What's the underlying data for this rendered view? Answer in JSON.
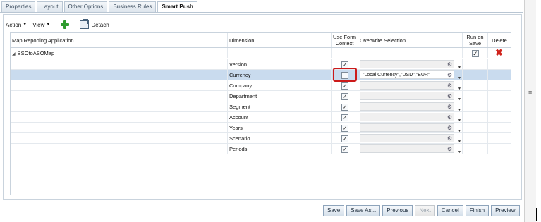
{
  "tabs": [
    "Properties",
    "Layout",
    "Other Options",
    "Business Rules",
    "Smart Push"
  ],
  "active_tab": "Smart Push",
  "toolbar": {
    "action_label": "Action",
    "view_label": "View",
    "detach_label": "Detach"
  },
  "columns": {
    "app": "Map Reporting Application",
    "dimension": "Dimension",
    "use_form_line1": "Use Form",
    "use_form_line2": "Context",
    "overwrite": "Overwrite Selection",
    "run_line1": "Run on",
    "run_line2": "Save",
    "delete": "Delete"
  },
  "mapping": {
    "name": "BSOtoASOMap",
    "run_on_save": true
  },
  "rows": [
    {
      "dimension": "Version",
      "use_form_context": true,
      "overwrite": ""
    },
    {
      "dimension": "Currency",
      "use_form_context": false,
      "overwrite": "\"Local Currency\",\"USD\",\"EUR\"",
      "selected": true
    },
    {
      "dimension": "Company",
      "use_form_context": true,
      "overwrite": ""
    },
    {
      "dimension": "Department",
      "use_form_context": true,
      "overwrite": ""
    },
    {
      "dimension": "Segment",
      "use_form_context": true,
      "overwrite": ""
    },
    {
      "dimension": "Account",
      "use_form_context": true,
      "overwrite": ""
    },
    {
      "dimension": "Years",
      "use_form_context": true,
      "overwrite": ""
    },
    {
      "dimension": "Scenario",
      "use_form_context": true,
      "overwrite": ""
    },
    {
      "dimension": "Periods",
      "use_form_context": true,
      "overwrite": ""
    }
  ],
  "footer": {
    "save": "Save",
    "save_as": "Save As...",
    "previous": "Previous",
    "next": "Next",
    "cancel": "Cancel",
    "finish": "Finish",
    "preview": "Preview"
  },
  "colors": {
    "highlight": "#cc1a1a",
    "selected_row": "#c9dbee",
    "delete_icon": "#d0231c",
    "add_icon": "#2e9b2e"
  }
}
